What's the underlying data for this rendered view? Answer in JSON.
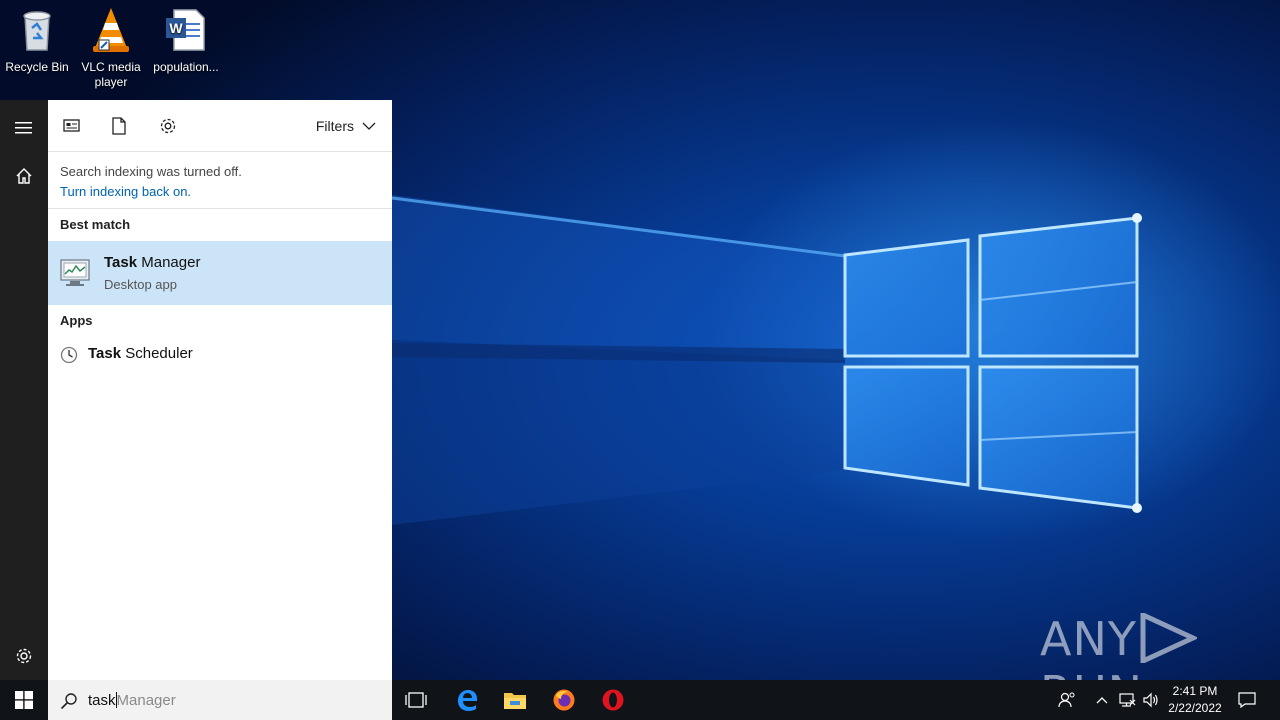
{
  "desktop": {
    "icons": [
      {
        "label": "Recycle Bin",
        "icon": "recycle-bin-icon"
      },
      {
        "label": "VLC media player",
        "icon": "vlc-icon"
      },
      {
        "label": "population...",
        "icon": "word-document-icon"
      }
    ],
    "watermark": {
      "left": "ANY",
      "right": "RUN"
    }
  },
  "start_rail": {
    "items": [
      {
        "icon": "hamburger-menu-icon"
      },
      {
        "icon": "home-icon"
      },
      {
        "icon": "settings-gear-icon"
      }
    ]
  },
  "search_panel": {
    "toolbar": {
      "icons": [
        "apps-icon",
        "documents-icon",
        "settings-icon"
      ],
      "filters_label": "Filters"
    },
    "notice": {
      "line1": "Search indexing was turned off.",
      "link": "Turn indexing back on."
    },
    "best_match": {
      "heading": "Best match",
      "item": {
        "title_bold": "Task",
        "title_rest": " Manager",
        "subtitle": "Desktop app"
      }
    },
    "apps": {
      "heading": "Apps",
      "items": [
        {
          "title_bold": "Task",
          "title_rest": " Scheduler"
        }
      ]
    }
  },
  "taskbar": {
    "search": {
      "typed": "task",
      "suggestion": "Manager"
    },
    "pinned": [
      "task-view-icon",
      "edge-icon",
      "file-explorer-icon",
      "firefox-icon",
      "opera-icon"
    ],
    "clock": {
      "time": "2:41 PM",
      "date": "2/22/2022"
    }
  },
  "colors": {
    "start_rail": "#1f1f1f",
    "selected_row": "#cce4f7",
    "link": "#0063b1",
    "taskbar": "#101418"
  }
}
